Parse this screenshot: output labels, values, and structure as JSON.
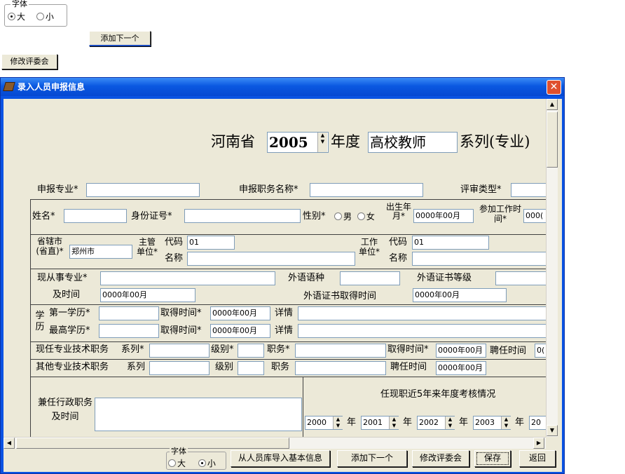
{
  "top_font_group": {
    "legend": "字体",
    "opt_large": "大",
    "opt_small": "小"
  },
  "top_add_next": "添加下一个",
  "top_modify_committee": "修改评委会",
  "window": {
    "title": "录入人员申报信息",
    "close": "✕"
  },
  "heading": {
    "province": "河南省",
    "year": "2005",
    "year_label": "年度",
    "series": "高校教师",
    "series_label": "系列(专业)"
  },
  "row_apply": {
    "major": "申报专业*",
    "title_name": "申报职务名称*",
    "review_type": "评审类型*"
  },
  "row_person": {
    "name": "姓名*",
    "id_no": "身份证号*",
    "gender": "性别*",
    "male": "男",
    "female": "女",
    "birth": "出生年月*",
    "birth_value": "0000年00月",
    "work_start": "参加工作时间*",
    "work_start_value": "000("
  },
  "row_unit": {
    "city": "省辖市(省直)*",
    "city_value": "郑州市",
    "supervisor": "主管单位*",
    "code": "代码",
    "code_value": "01",
    "name": "名称",
    "work_unit": "工作单位*",
    "code2": "代码",
    "code2_value": "01",
    "name2": "名称"
  },
  "row_major": {
    "current_major": "现从事专业*",
    "time": "及时间",
    "time_value": "0000年00月",
    "lang": "外语语种",
    "lang_grade": "外语证书等级",
    "lang_time": "外语证书取得时间",
    "lang_time_value": "0000年00月"
  },
  "row_edu": {
    "edu": "学历",
    "first": "第一学历*",
    "highest": "最高学历*",
    "obtain": "取得时间*",
    "obtain_value1": "0000年00月",
    "obtain_value2": "0000年00月",
    "detail": "详情"
  },
  "row_post": {
    "current": "现任专业技术职务",
    "other": "其他专业技术职务",
    "series": "系列*",
    "series2": "系列",
    "level": "级别*",
    "level2": "级别",
    "post": "职务*",
    "post2": "职务",
    "obtain": "取得时间*",
    "obtain_value": "0000年00月",
    "hire": "聘任时间",
    "hire_value": "0(",
    "hire2": "聘任时间",
    "hire2_value": "0000年00月"
  },
  "row_admin": {
    "label": "兼任行政职务及时间",
    "assess": "任现职近5年来年度考核情况",
    "years": [
      "2000",
      "2001",
      "2002",
      "2003",
      "20"
    ],
    "year_unit": "年"
  },
  "bottom": {
    "font_legend": "字体",
    "opt_large": "大",
    "opt_small": "小",
    "import": "从人员库导入基本信息",
    "add_next": "添加下一个",
    "modify": "修改评委会",
    "save": "保存",
    "back": "返回"
  }
}
